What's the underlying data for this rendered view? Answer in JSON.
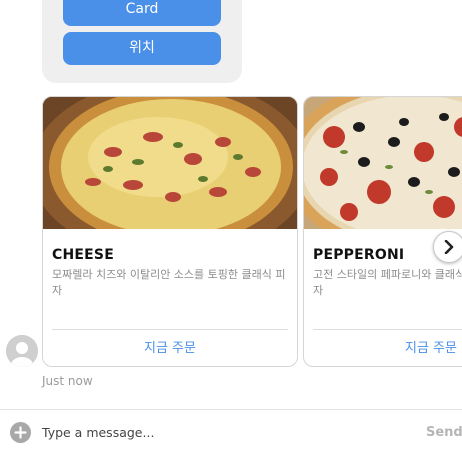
{
  "menu": {
    "buttons": [
      {
        "label": "Card"
      },
      {
        "label": "위치"
      }
    ]
  },
  "carousel": {
    "cards": [
      {
        "title": "CHEESE",
        "description": "모짜렐라 치즈와 이탈리안 소스를 토핑한 클래식 피자",
        "action": "지금 주문",
        "image": "cheese-pizza-image"
      },
      {
        "title": "PEPPERONI",
        "description": "고전 스타일의 페파로니와 클래식 소스를 토핑한 피자",
        "action": "지금 주문",
        "image": "pepperoni-pizza-image"
      }
    ],
    "next_icon": "chevron-right-icon"
  },
  "message": {
    "timestamp": "Just now"
  },
  "composer": {
    "placeholder": "Type a message...",
    "send_label": "Send",
    "plus_icon": "plus-circle-icon"
  },
  "colors": {
    "accent": "#4a90e8",
    "card_bubble": "#efefef"
  }
}
